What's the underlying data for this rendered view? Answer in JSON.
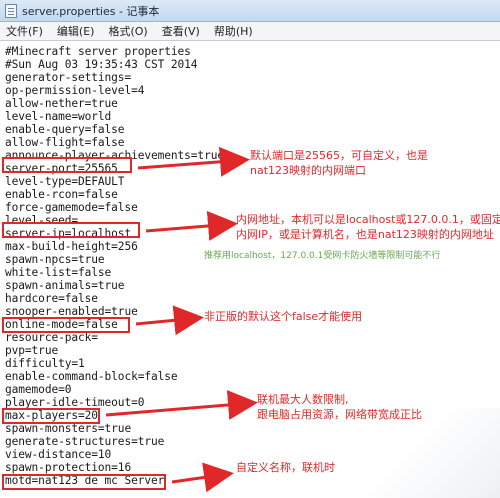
{
  "window": {
    "title": "server.properties - 记事本"
  },
  "menubar": {
    "items": [
      "文件(F)",
      "编辑(E)",
      "格式(O)",
      "查看(V)",
      "帮助(H)"
    ]
  },
  "editor": {
    "lines": [
      "#Minecraft server properties",
      "#Sun Aug 03 19:35:43 CST 2014",
      "generator-settings=",
      "op-permission-level=4",
      "allow-nether=true",
      "level-name=world",
      "enable-query=false",
      "allow-flight=false",
      "announce-player-achievements=true",
      "server-port=25565",
      "level-type=DEFAULT",
      "enable-rcon=false",
      "force-gamemode=false",
      "level-seed=",
      "server-ip=localhost",
      "max-build-height=256",
      "spawn-npcs=true",
      "white-list=false",
      "spawn-animals=true",
      "hardcore=false",
      "snooper-enabled=true",
      "online-mode=false",
      "resource-pack=",
      "pvp=true",
      "difficulty=1",
      "enable-command-block=false",
      "gamemode=0",
      "player-idle-timeout=0",
      "max-players=20",
      "spawn-monsters=true",
      "generate-structures=true",
      "view-distance=10",
      "spawn-protection=16",
      "motd=nat123 de mc Server"
    ]
  },
  "annotations": {
    "port": [
      "默认端口是25565，可自定义，也是",
      "nat123映射的内网端口"
    ],
    "ip": [
      "内网地址，本机可以是localhost或127.0.0.1，或固定",
      "内网IP，或是计算机名，也是nat123映射的内网地址"
    ],
    "ip_tip": "推荐用localhost，127.0.0.1受网卡防火墙等限制可能不行",
    "online": "非正版的默认这个false才能使用",
    "players": [
      "联机最大人数限制,",
      "跟电脑占用资源，网络带宽成正比"
    ],
    "motd": "自定义名称，联机时"
  },
  "colors": {
    "annotation": "#e0282a",
    "tip": "#6aa84f"
  }
}
